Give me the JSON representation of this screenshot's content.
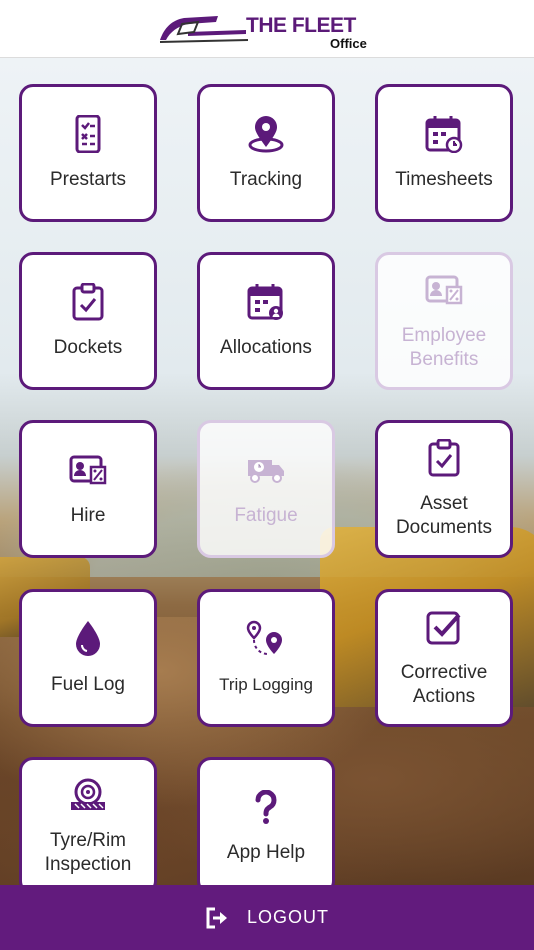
{
  "header": {
    "brand": "THE FLEET",
    "sub": "Office"
  },
  "tiles": [
    {
      "id": "prestarts",
      "label": "Prestarts",
      "icon": "phone-checklist-icon",
      "enabled": true
    },
    {
      "id": "tracking",
      "label": "Tracking",
      "icon": "map-pin-icon",
      "enabled": true
    },
    {
      "id": "timesheets",
      "label": "Timesheets",
      "icon": "calendar-clock-icon",
      "enabled": true
    },
    {
      "id": "dockets",
      "label": "Dockets",
      "icon": "clipboard-check-icon",
      "enabled": true
    },
    {
      "id": "allocations",
      "label": "Allocations",
      "icon": "calendar-user-icon",
      "enabled": true
    },
    {
      "id": "employee-benefits",
      "label_line1": "Employee",
      "label_line2": "Benefits",
      "icon": "id-card-percent-icon",
      "enabled": false
    },
    {
      "id": "hire",
      "label": "Hire",
      "icon": "id-card-percent-icon",
      "enabled": true
    },
    {
      "id": "fatigue",
      "label": "Fatigue",
      "icon": "truck-clock-icon",
      "enabled": false
    },
    {
      "id": "asset-documents",
      "label_line1": "Asset",
      "label_line2": "Documents",
      "icon": "clipboard-check-icon",
      "enabled": true
    },
    {
      "id": "fuel-log",
      "label": "Fuel Log",
      "icon": "droplet-icon",
      "enabled": true
    },
    {
      "id": "trip-logging",
      "label": "Trip Logging",
      "icon": "route-pins-icon",
      "enabled": true
    },
    {
      "id": "corrective-actions",
      "label_line1": "Corrective",
      "label_line2": "Actions",
      "icon": "checkbox-icon",
      "enabled": true
    },
    {
      "id": "tyre-rim-inspection",
      "label_line1": "Tyre/Rim",
      "label_line2": "Inspection",
      "icon": "tyre-icon",
      "enabled": true
    },
    {
      "id": "app-help",
      "label": "App Help",
      "icon": "question-mark-icon",
      "enabled": true
    }
  ],
  "footer": {
    "logout_label": "LOGOUT",
    "icon": "logout-icon"
  },
  "colors": {
    "primary": "#5c1a7a",
    "footer": "#621b7d",
    "disabled_border": "#d9c9e3",
    "disabled_text": "#c7b3d3"
  }
}
